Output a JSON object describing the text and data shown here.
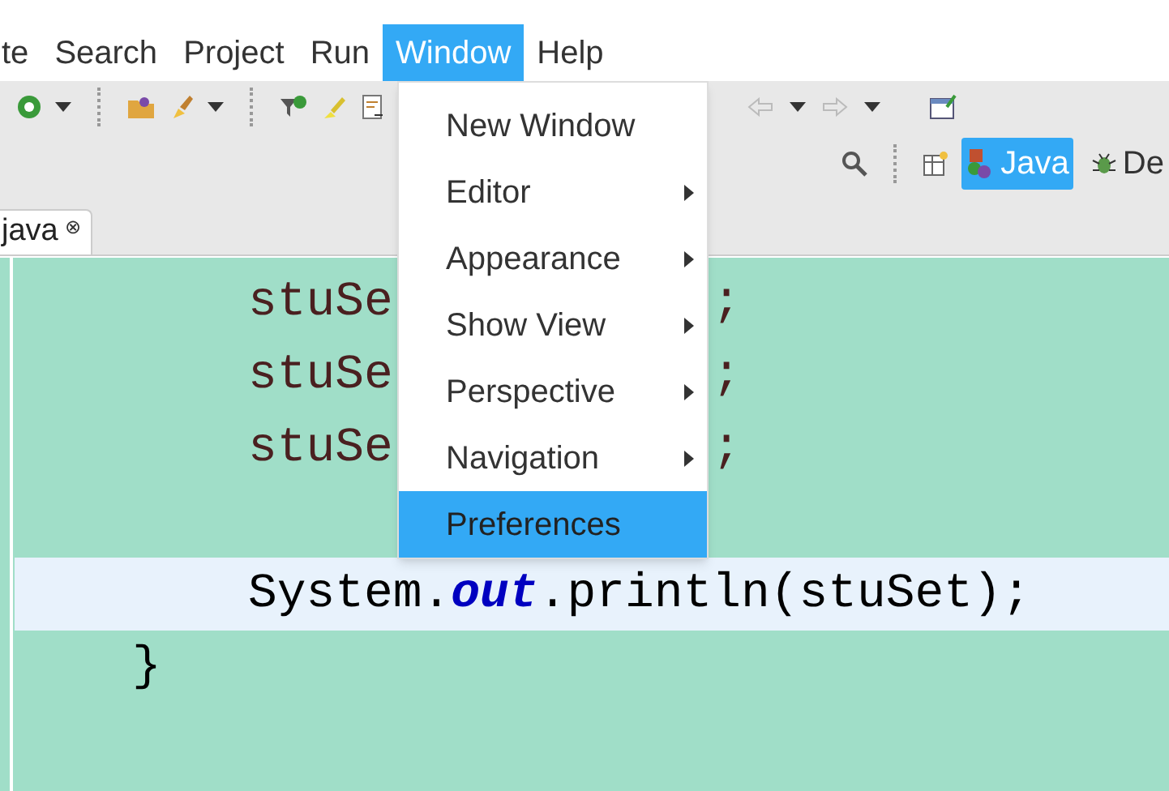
{
  "menubar": [
    {
      "label": "te",
      "selected": false
    },
    {
      "label": "Search",
      "selected": false
    },
    {
      "label": "Project",
      "selected": false
    },
    {
      "label": "Run",
      "selected": false
    },
    {
      "label": "Window",
      "selected": true
    },
    {
      "label": "Help",
      "selected": false
    }
  ],
  "perspectives": [
    {
      "label": "Java",
      "selected": true,
      "kind": "java"
    },
    {
      "label": "De",
      "selected": false,
      "kind": "debug"
    }
  ],
  "editor_tab": {
    "label": "java",
    "close": "⊗"
  },
  "code_lines": [
    {
      "kind": "plain",
      "segments": [
        {
          "text": "stuSe"
        },
        {
          "text": ";",
          "kind": "after_menu"
        }
      ]
    },
    {
      "kind": "plain",
      "segments": [
        {
          "text": "stuSe"
        },
        {
          "text": ";",
          "kind": "after_menu"
        }
      ]
    },
    {
      "kind": "plain",
      "segments": [
        {
          "text": "stuSe"
        },
        {
          "text": ";",
          "kind": "after_menu"
        }
      ]
    },
    {
      "kind": "blank"
    },
    {
      "kind": "current",
      "segments": [
        {
          "text": "System."
        },
        {
          "text": "out",
          "kind": "field"
        },
        {
          "text": ".println(stuSet);"
        }
      ]
    },
    {
      "kind": "plain",
      "segments": [
        {
          "text": "}",
          "kind": "outdent"
        }
      ]
    }
  ],
  "menu": [
    {
      "label": "New Window",
      "submenu": false,
      "selected": false
    },
    {
      "label": "Editor",
      "submenu": true,
      "selected": false
    },
    {
      "label": "Appearance",
      "submenu": true,
      "selected": false
    },
    {
      "label": "Show View",
      "submenu": true,
      "selected": false
    },
    {
      "label": "Perspective",
      "submenu": true,
      "selected": false
    },
    {
      "label": "Navigation",
      "submenu": true,
      "selected": false
    },
    {
      "label": "Preferences",
      "submenu": false,
      "selected": true
    }
  ]
}
